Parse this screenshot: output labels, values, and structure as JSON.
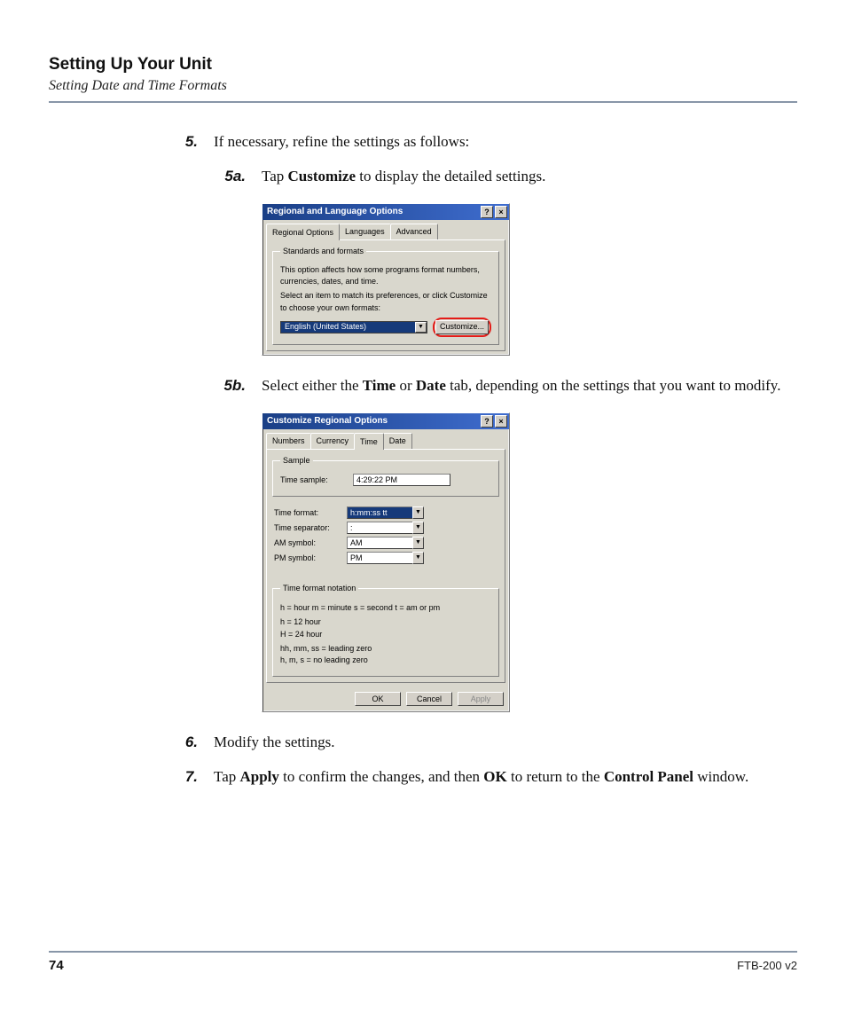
{
  "header": {
    "title": "Setting Up Your Unit",
    "subtitle": "Setting Date and Time Formats"
  },
  "footer": {
    "page": "74",
    "model": "FTB-200 v2"
  },
  "steps": {
    "s5": {
      "num": "5.",
      "text": "If necessary, refine the settings as follows:"
    },
    "s5a": {
      "num": "5a.",
      "pre": "Tap ",
      "bold": "Customize",
      "post": " to display the detailed settings."
    },
    "s5b": {
      "num": "5b.",
      "pre": "Select either the ",
      "bold1": "Time",
      "mid": " or ",
      "bold2": "Date",
      "post": " tab, depending on the settings that you want to modify."
    },
    "s6": {
      "num": "6.",
      "text": "Modify the settings."
    },
    "s7": {
      "num": "7.",
      "pre": "Tap ",
      "bold1": "Apply",
      "mid": " to confirm the changes, and then ",
      "bold2": "OK",
      "post": " to return to the ",
      "bold3": "Control Panel",
      "post2": " window."
    }
  },
  "win1": {
    "title": "Regional and Language Options",
    "tabs": [
      "Regional Options",
      "Languages",
      "Advanced"
    ],
    "group_legend": "Standards and formats",
    "hint1": "This option affects how some programs format numbers, currencies, dates, and time.",
    "hint2": "Select an item to match its preferences, or click Customize to choose your own formats:",
    "select_value": "English (United States)",
    "customize_btn": "Customize...",
    "help": "?",
    "close": "×"
  },
  "win2": {
    "title": "Customize Regional Options",
    "tabs": [
      "Numbers",
      "Currency",
      "Time",
      "Date"
    ],
    "help": "?",
    "close": "×",
    "sample_legend": "Sample",
    "sample_label": "Time sample:",
    "sample_value": "4:29:22 PM",
    "fields": {
      "time_format": {
        "label": "Time format:",
        "value": "h:mm:ss tt"
      },
      "time_sep": {
        "label": "Time separator:",
        "value": ":"
      },
      "am": {
        "label": "AM symbol:",
        "value": "AM"
      },
      "pm": {
        "label": "PM symbol:",
        "value": "PM"
      }
    },
    "notation_legend": "Time format notation",
    "notation1": "h = hour    m = minute    s = second    t = am or pm",
    "notation2": "h = 12 hour",
    "notation3": "H = 24 hour",
    "notation4": "hh, mm, ss = leading zero",
    "notation5": "h, m, s = no leading zero",
    "buttons": {
      "ok": "OK",
      "cancel": "Cancel",
      "apply": "Apply"
    }
  }
}
